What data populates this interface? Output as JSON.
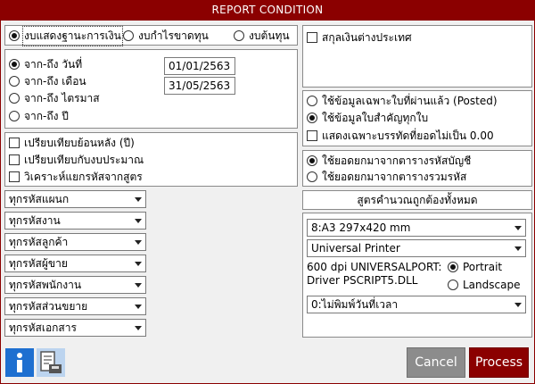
{
  "window": {
    "title": "REPORT CONDITION"
  },
  "report_type": {
    "options": [
      {
        "label": "งบแสดงฐานะการเงิน",
        "selected": true
      },
      {
        "label": "งบกำไรขาดทุน",
        "selected": false
      },
      {
        "label": "งบต้นทุน",
        "selected": false
      }
    ]
  },
  "foreign_currency": {
    "label": "สกุลเงินต่างประเทศ",
    "checked": false
  },
  "period": {
    "options": [
      {
        "label": "จาก-ถึง วันที่",
        "selected": true
      },
      {
        "label": "จาก-ถึง เดือน",
        "selected": false
      },
      {
        "label": "จาก-ถึง ไตรมาส",
        "selected": false
      },
      {
        "label": "จาก-ถึง ปี",
        "selected": false
      }
    ],
    "date_from": "01/01/2563",
    "date_to": "31/05/2563"
  },
  "data_source": {
    "options": [
      {
        "label": "ใช้ข้อมูลเฉพาะใบที่ผ่านแล้ว (Posted)",
        "selected": false
      },
      {
        "label": "ใช้ข้อมูลใบสำคัญทุกใบ",
        "selected": true
      }
    ],
    "nonzero_only": {
      "label": "แสดงเฉพาะบรรทัดที่ยอดไม่เป็น 0.00",
      "checked": false
    }
  },
  "compare": {
    "items": [
      {
        "label": "เปรียบเทียบย้อนหลัง (ปี)",
        "checked": false
      },
      {
        "label": "เปรียบเทียบกับงบประมาณ",
        "checked": false
      },
      {
        "label": "วิเคราะห์แยกรหัสจากสูตร",
        "checked": false
      }
    ]
  },
  "balance_source": {
    "options": [
      {
        "label": "ใช้ยอดยกมาจากตารางรหัสบัญชี",
        "selected": true
      },
      {
        "label": "ใช้ยอดยกมาจากตารางรวมรหัส",
        "selected": false
      }
    ]
  },
  "filters": [
    "ทุกรหัสแผนก",
    "ทุกรหัสงาน",
    "ทุกรหัสลูกค้า",
    "ทุกรหัสผู้ขาย",
    "ทุกรหัสพนักงาน",
    "ทุกรหัสส่วนขยาย",
    "ทุกรหัสเอกสาร"
  ],
  "formula_header": "สูตรคำนวณถูกต้องทั้งหมด",
  "print": {
    "paper": "8:A3 297x420 mm",
    "printer": "Universal Printer",
    "printer_info_line1": "600 dpi  UNIVERSALPORT:",
    "printer_info_line2": "Driver PSCRIPT5.DLL",
    "orientation": [
      {
        "label": "Portrait",
        "selected": true
      },
      {
        "label": "Landscape",
        "selected": false
      }
    ],
    "time_option": "0:ไม่พิมพ์วันที่เวลา"
  },
  "buttons": {
    "cancel": "Cancel",
    "process": "Process"
  },
  "colors": {
    "title_bar": "#8b0000",
    "cancel_button": "#8c8c8c",
    "process_button": "#8b0000",
    "info_icon": "#1e6fd0"
  },
  "icons": {
    "info": "info-icon",
    "print_setup": "print-setup-icon"
  }
}
